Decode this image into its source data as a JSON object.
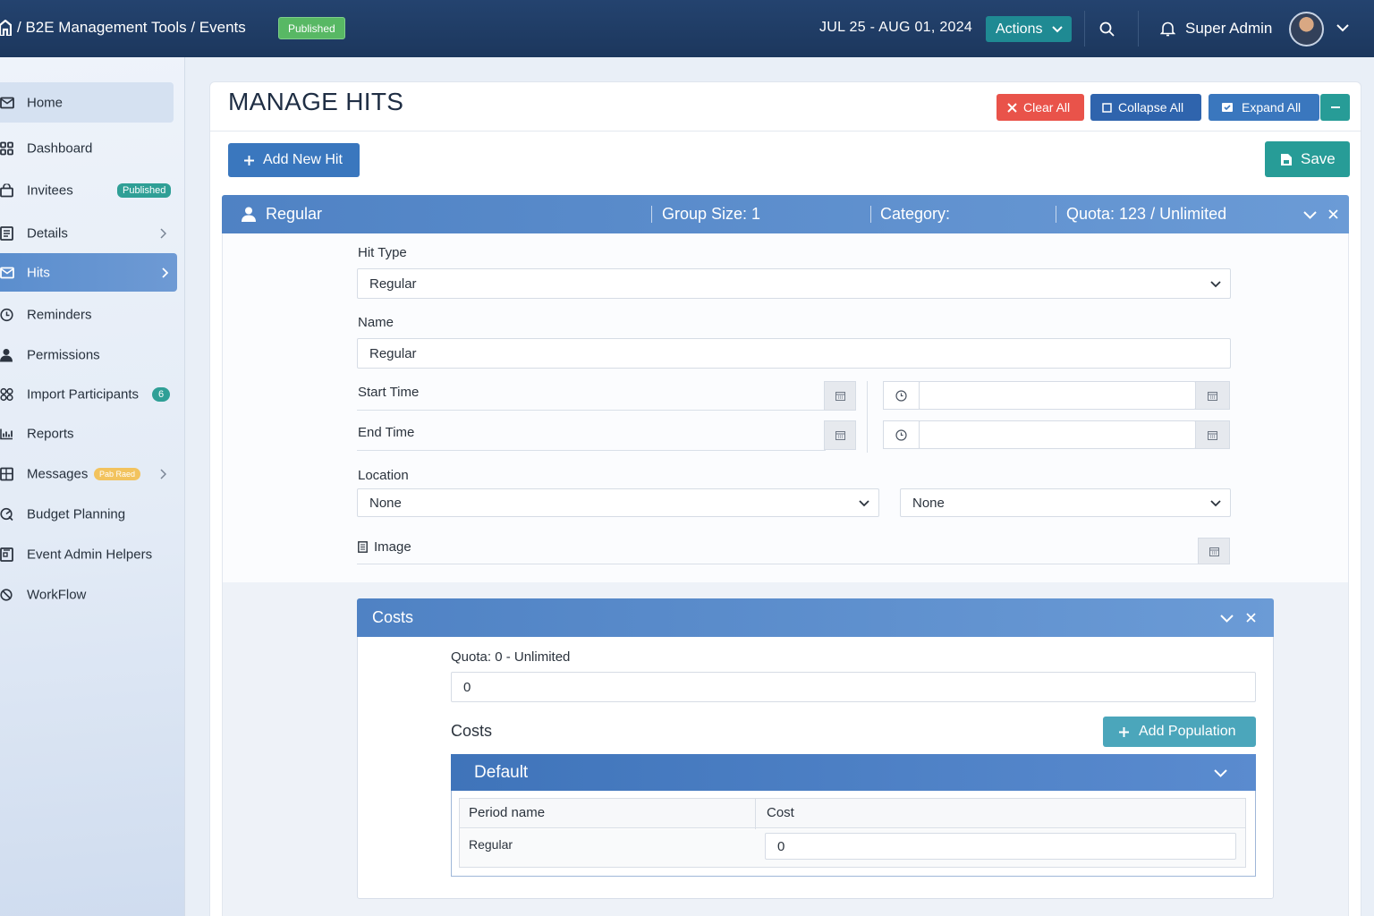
{
  "topbar": {
    "breadcrumb": "/ B2E Management Tools / Events",
    "status_badge": "Published",
    "date_range": "JUL 25 - AUG 01, 2024",
    "actions_label": "Actions",
    "user_name": "Super Admin"
  },
  "sidebar": {
    "items": [
      {
        "label": "Home"
      },
      {
        "label": "Dashboard"
      },
      {
        "label": "Invitees",
        "badge": "Published"
      },
      {
        "label": "Details"
      },
      {
        "label": "Hits"
      },
      {
        "label": "Reminders"
      },
      {
        "label": "Permissions"
      },
      {
        "label": "Import Participants",
        "badge": "6"
      },
      {
        "label": "Reports"
      },
      {
        "label": "Messages",
        "badge": "Pab Raed"
      },
      {
        "label": "Budget Planning"
      },
      {
        "label": "Event Admin Helpers"
      },
      {
        "label": "WorkFlow"
      }
    ]
  },
  "page": {
    "title": "MANAGE HITS",
    "clear_all": "Clear All",
    "collapse_all": "Collapse All",
    "expand_all": "Expand All",
    "add_new_hit": "Add New Hit",
    "save": "Save"
  },
  "hit": {
    "name": "Regular",
    "group_size": "Group Size: 1",
    "category": "Category:",
    "quota": "Quota: 123 / Unlimited",
    "hit_type_label": "Hit Type",
    "hit_type_value": "Regular",
    "name_label": "Name",
    "name_value": "Regular",
    "start_time_label": "Start Time",
    "end_time_label": "End Time",
    "location_label": "Location",
    "location_value_1": "None",
    "location_value_2": "None",
    "image_label": "Image"
  },
  "costs": {
    "title": "Costs",
    "quota_label": "Quota: 0 - Unlimited",
    "quota_value": "0",
    "section_label": "Costs",
    "add_population": "Add Population",
    "population": {
      "name": "Default",
      "columns": [
        "Period name",
        "Cost"
      ],
      "rows": [
        {
          "period": "Regular",
          "cost": "0"
        }
      ]
    }
  },
  "colors": {
    "topbar": "#1f3c64",
    "panel_header": "#5b8ecf",
    "clear_all": "#e9534a",
    "collapse_all": "#2f64ad",
    "save": "#279c97",
    "add_population": "#4ba6bb",
    "published_badge": "#58b864"
  }
}
